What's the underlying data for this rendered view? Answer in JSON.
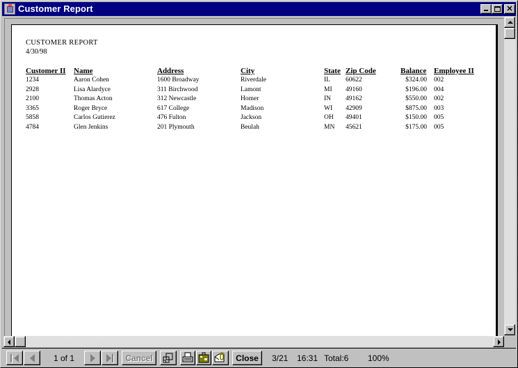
{
  "window": {
    "title": "Customer Report",
    "controls": {
      "minimize": "minimize",
      "maximize": "maximize",
      "close": "✕"
    }
  },
  "report": {
    "title": "CUSTOMER REPORT",
    "date": "4/30/98",
    "columns": [
      "Customer II",
      "Name",
      "Address",
      "City",
      "State",
      "Zip Code",
      "Balance",
      "Employee II"
    ],
    "rows": [
      [
        "1234",
        "Aaron Cohen",
        "1600 Broadway",
        "Riverdale",
        "IL",
        "60622",
        "$324.00",
        "002"
      ],
      [
        "2928",
        "Lisa Alardyce",
        "311 Birchwood",
        "Lamont",
        "MI",
        "49160",
        "$196.00",
        "004"
      ],
      [
        "2100",
        "Thomas Acton",
        "312 Newcastle",
        "Homer",
        "IN",
        "49162",
        "$550.00",
        "002"
      ],
      [
        "3365",
        "Roger Bryce",
        "617 College",
        "Madison",
        "WI",
        "42909",
        "$875.00",
        "003"
      ],
      [
        "5858",
        "Carlos Gutierez",
        "476 Fulton",
        "Jackson",
        "OH",
        "49401",
        "$150.00",
        "005"
      ],
      [
        "4784",
        "Glen Jenkins",
        "201 Plymouth",
        "Beulah",
        "MN",
        "45621",
        "$175.00",
        "005"
      ]
    ]
  },
  "toolbar": {
    "page_indicator": "1 of 1",
    "cancel_label": "Cancel",
    "close_label": "Close",
    "date": "3/21",
    "time": "16:31",
    "total": "Total:6",
    "zoom": "100%",
    "icons": [
      "first-page-icon",
      "prev-page-icon",
      "next-page-icon",
      "last-page-icon",
      "zoom-window-icon",
      "print-icon",
      "export-icon",
      "mail-icon"
    ]
  }
}
